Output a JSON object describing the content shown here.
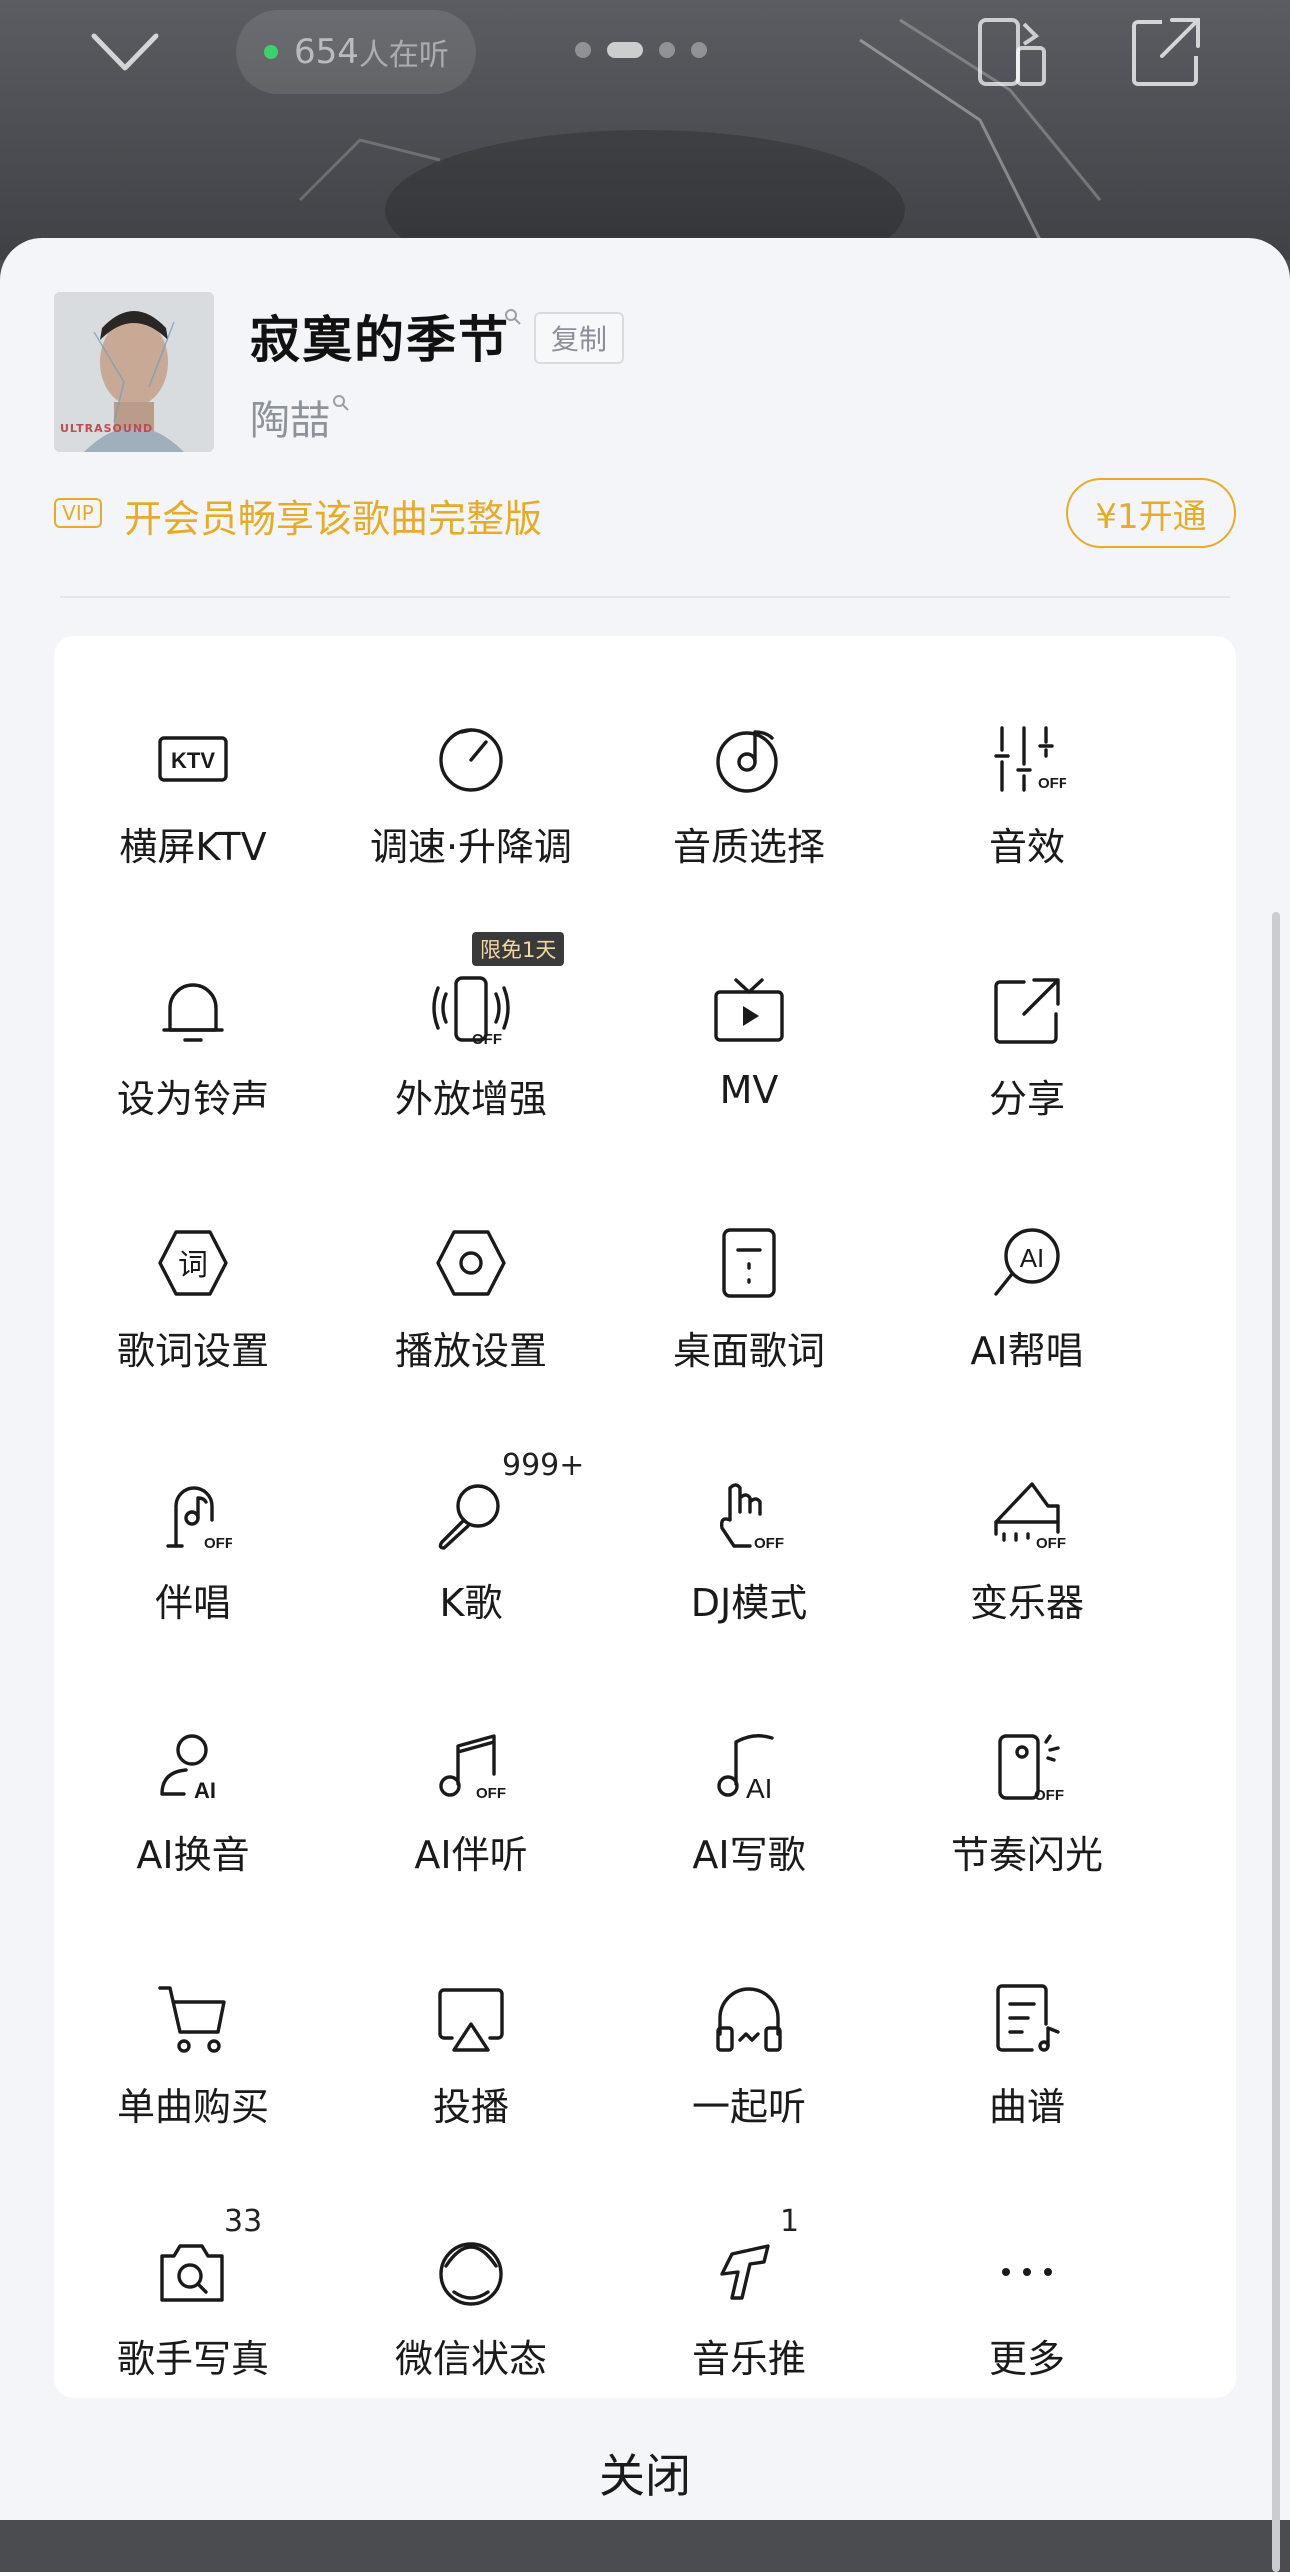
{
  "header": {
    "listener_count": "654",
    "listener_label": "人在听",
    "pager": {
      "count": 4,
      "active": 1
    }
  },
  "song": {
    "title": "寂寞的季节",
    "copy_label": "复制",
    "artist": "陶喆",
    "cover_caption": "ULTRASOUND"
  },
  "vip": {
    "badge": "VIP",
    "text": "开会员畅享该歌曲完整版",
    "button": "¥1开通"
  },
  "menu": [
    {
      "label": "横屏KTV",
      "icon": "ktv-icon"
    },
    {
      "label": "调速·升降调",
      "icon": "speed-dial-icon"
    },
    {
      "label": "音质选择",
      "icon": "disc-note-icon"
    },
    {
      "label": "音效",
      "icon": "equalizer-off-icon"
    },
    {
      "label": "设为铃声",
      "icon": "bell-icon"
    },
    {
      "label": "外放增强",
      "icon": "phone-speaker-off-icon",
      "tag": "限免1天"
    },
    {
      "label": "MV",
      "icon": "tv-play-icon"
    },
    {
      "label": "分享",
      "icon": "share-icon"
    },
    {
      "label": "歌词设置",
      "icon": "lyrics-hexagon-icon",
      "glyph": "词"
    },
    {
      "label": "播放设置",
      "icon": "hexagon-settings-icon"
    },
    {
      "label": "桌面歌词",
      "icon": "desktop-lyrics-icon"
    },
    {
      "label": "AI帮唱",
      "icon": "ai-sing-icon"
    },
    {
      "label": "伴唱",
      "icon": "accompany-off-icon"
    },
    {
      "label": "K歌",
      "icon": "microphone-icon",
      "count": "999+"
    },
    {
      "label": "DJ模式",
      "icon": "dj-hand-off-icon"
    },
    {
      "label": "变乐器",
      "icon": "piano-off-icon"
    },
    {
      "label": "AI换音",
      "icon": "ai-voice-icon"
    },
    {
      "label": "AI伴听",
      "icon": "ai-companion-off-icon"
    },
    {
      "label": "AI写歌",
      "icon": "ai-write-icon"
    },
    {
      "label": "节奏闪光",
      "icon": "flash-off-icon"
    },
    {
      "label": "单曲购买",
      "icon": "cart-icon"
    },
    {
      "label": "投播",
      "icon": "airplay-icon"
    },
    {
      "label": "一起听",
      "icon": "headphones-icon"
    },
    {
      "label": "曲谱",
      "icon": "sheet-music-icon"
    },
    {
      "label": "歌手写真",
      "icon": "camera-search-icon",
      "count": "33"
    },
    {
      "label": "微信状态",
      "icon": "status-icon"
    },
    {
      "label": "音乐推",
      "icon": "music-push-icon",
      "count": "1"
    },
    {
      "label": "更多",
      "icon": "more-icon"
    }
  ],
  "close_label": "关闭",
  "colors": {
    "accent": "#e5ac2c",
    "sheet": "#f3f5f8",
    "panel": "#ffffff"
  }
}
